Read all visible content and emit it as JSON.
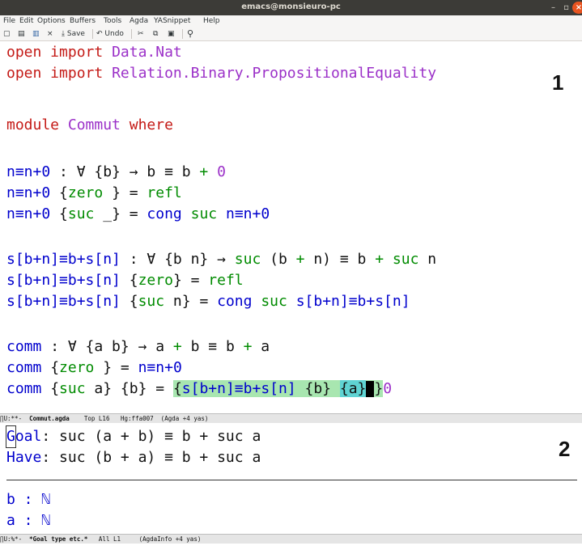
{
  "window": {
    "title": "emacs@monsieuro-pc",
    "buttons": {
      "minimize": "–",
      "maximize": "▫",
      "close": "×"
    }
  },
  "menubar": [
    "File",
    "Edit",
    "Options",
    "Buffers",
    "Tools",
    "Agda",
    "YASnippet",
    "Help"
  ],
  "toolbar": {
    "new_icon": "▢",
    "open_icon": "▤",
    "dired_icon": "▥",
    "close_icon": "×",
    "save_icon": "⤓",
    "save_label": "Save",
    "undo_icon": "↶",
    "undo_label": "Undo",
    "cut_icon": "✂",
    "copy_icon": "⧉",
    "paste_icon": "▣",
    "search_icon": "⚲"
  },
  "annotations": {
    "editor": "1",
    "goal": "2"
  },
  "code": {
    "l1": {
      "kw": "open import",
      "sp": " ",
      "mod": "Data.Nat"
    },
    "l2": {
      "kw": "open import",
      "sp": " ",
      "mod": "Relation.Binary.PropositionalEquality"
    },
    "l3": {
      "kw": "module",
      "sp": " ",
      "mod": "Commut",
      "sp2": " ",
      "kw2": "where"
    },
    "l4": {
      "fn": "n≡n+0",
      "p1": " : ∀ {b} → b ≡ b ",
      "op": "+",
      "sp": " ",
      "num": "0"
    },
    "l5": {
      "fn": "n≡n+0",
      "p1": " {",
      "con": "zero",
      "p2": " } = ",
      "con2": "refl"
    },
    "l6": {
      "fn": "n≡n+0",
      "p1": " {",
      "con": "suc",
      "p2": " _} = ",
      "fn2": "cong",
      "sp": " ",
      "con2": "suc",
      "sp2": " ",
      "fn3": "n≡n+0"
    },
    "l7": {
      "fn": "s[b+n]≡b+s[n]",
      "p1": " : ∀ {b n} → ",
      "con": "suc",
      "p2": " (b ",
      "op": "+",
      "p3": " n) ≡ b ",
      "op2": "+",
      "sp": " ",
      "con2": "suc",
      "p4": " n"
    },
    "l8": {
      "fn": "s[b+n]≡b+s[n]",
      "p1": " {",
      "con": "zero",
      "p2": "} = ",
      "con2": "refl"
    },
    "l9": {
      "fn": "s[b+n]≡b+s[n]",
      "p1": " {",
      "con": "suc",
      "p2": " n} = ",
      "fn2": "cong",
      "sp": " ",
      "con2": "suc",
      "sp2": " ",
      "fn3": "s[b+n]≡b+s[n]"
    },
    "l10": {
      "fn": "comm",
      "p1": " : ∀ {a b} → a ",
      "op": "+",
      "p2": " b ≡ b ",
      "op2": "+",
      "p3": " a"
    },
    "l11": {
      "fn": "comm",
      "p1": " {",
      "con": "zero",
      "p2": " } = ",
      "fn2": "n≡n+0"
    },
    "l12": {
      "fn": "comm",
      "p1": " {",
      "con": "suc",
      "p2": " a} {b} = ",
      "hole_open": "{",
      "hole_fn": "s[b+n]≡b+s[n]",
      "hole_mid": " {b} ",
      "hole_a": "{a}",
      "hole_close": "}",
      "tail": "0"
    }
  },
  "modeline1": {
    "status": "∏U:**-  ",
    "buffer": "Commut.agda",
    "rest": "    Top L16   Hg:ffa007  (Agda +4 yas)"
  },
  "goal": {
    "goal_label": "Goal",
    "goal_first": "G",
    "goal_rest": "oal",
    "goal_text": ": suc (a + b) ≡ b + suc a",
    "have_label": "Have",
    "have_text": ": suc (b + a) ≡ b + suc a",
    "ctx1": "b : ℕ",
    "ctx2": "a : ℕ"
  },
  "modeline2": {
    "status": "∏U:%*-  ",
    "buffer": "*Goal type etc.*",
    "rest": "   All L1     (AgdaInfo +4 yas)"
  }
}
